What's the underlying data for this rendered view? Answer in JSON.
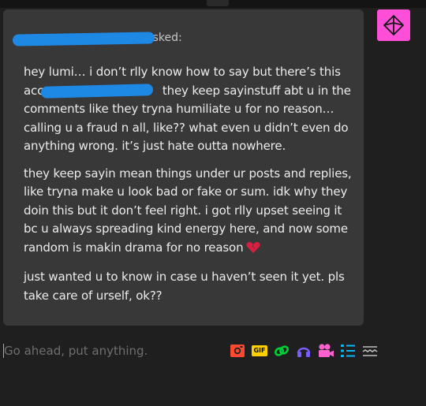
{
  "ask": {
    "asker_suffix": "asked:",
    "paragraphs": {
      "p1": {
        "l1": "hey lumi… i don’t rlly know how to say but there’s this",
        "l2a": "acc",
        "l2b": " they keep sayinstuff abt u in the",
        "l3": "comments like they tryna humiliate u for no reason…",
        "l4": "calling u a fraud n all, like?? what even u didn’t even do",
        "l5": "anything wrong. it’s just hate outta nowhere."
      },
      "p2": {
        "l1": "they keep sayin mean things under ur posts and replies,",
        "l2": "like tryna make u look bad or fake or sum. idk why they",
        "l3": "doin this but it don’t feel right. i got rlly upset seeing it",
        "l4": "bc u always spreading kind energy here, and now some",
        "l5": "random is makin drama for no reason"
      },
      "p3": {
        "l1": "just wanted u to know in case u haven’t seen it yet. pls",
        "l2": "take care of urself, ok??"
      }
    }
  },
  "reply": {
    "placeholder": "Go ahead, put anything.",
    "gif_label": "GIF"
  },
  "colors": {
    "page_bg": "#1f1f1f",
    "bubble_bg": "#383838",
    "avatar_bg": "#ff4fd8",
    "redaction": "#1e88e5"
  },
  "icons": [
    "broken-heart-icon",
    "photo-icon",
    "gif-icon",
    "link-icon",
    "audio-icon",
    "video-icon",
    "list-icon",
    "read-more-icon"
  ]
}
